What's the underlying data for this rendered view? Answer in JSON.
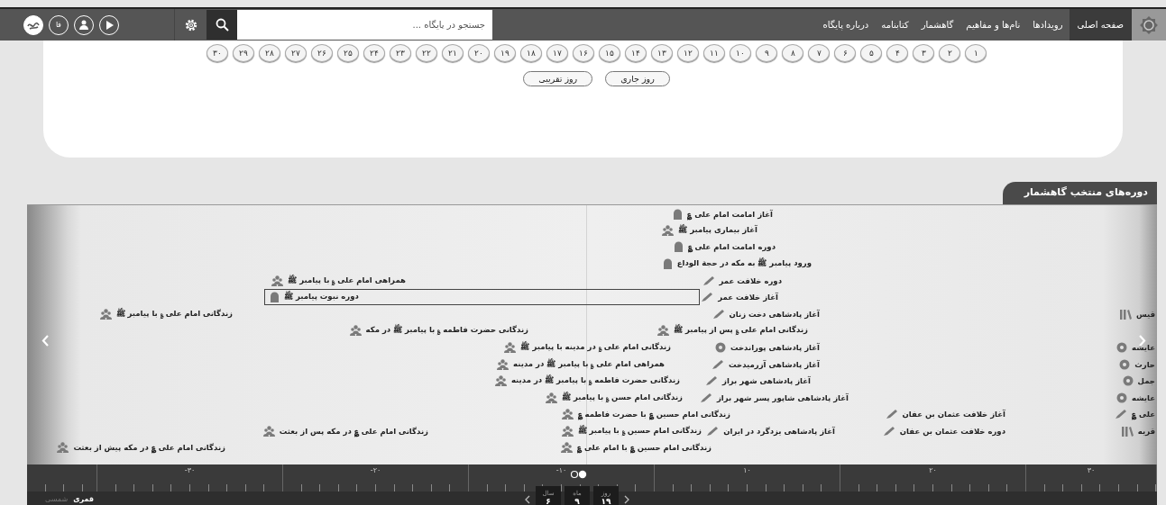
{
  "nav": {
    "items": [
      {
        "label": "صفحه اصلی",
        "selected": true
      },
      {
        "label": "رویدادها",
        "selected": false
      },
      {
        "label": "نام‌ها و مفاهیم",
        "selected": false
      },
      {
        "label": "گاهشمار",
        "selected": false
      },
      {
        "label": "کتابنامه",
        "selected": false
      },
      {
        "label": "درباره پایگاه",
        "selected": false
      }
    ],
    "search": {
      "placeholder": "جستجو در پایگاه ..."
    },
    "language": "فا"
  },
  "days": [
    "۱",
    "۲",
    "۳",
    "۴",
    "۵",
    "۶",
    "۷",
    "۸",
    "۹",
    "۱۰",
    "۱۱",
    "۱۲",
    "۱۳",
    "۱۴",
    "۱۵",
    "۱۶",
    "۱۷",
    "۱۸",
    "۱۹",
    "۲۰",
    "۲۱",
    "۲۲",
    "۲۳",
    "۲۴",
    "۲۵",
    "۲۶",
    "۲۷",
    "۲۸",
    "۲۹",
    "۳۰"
  ],
  "day_buttons": [
    "روز جاری",
    "روز تقریبی"
  ],
  "section_title": "دوره‌های منتخب گاهشمار",
  "timeline": {
    "events": [
      {
        "text": "آغاز امامت امام علی ؏",
        "kind": "dome",
        "selected": false
      },
      {
        "text": "آغاز بیماری پیامبر ﷺ",
        "kind": "people",
        "selected": false
      },
      {
        "text": "دوره امامت امام علی ؏",
        "kind": "dome",
        "selected": false
      },
      {
        "text": "ورود پیامبر ﷺ به مکه در حجة الوداع",
        "kind": "dome",
        "selected": false
      },
      {
        "text": "دوره خلافت عمر",
        "kind": "pen",
        "selected": false
      },
      {
        "text": "همراهی امام علی ؏ با پیامبر ﷺ",
        "kind": "people",
        "selected": false
      },
      {
        "text": "آغاز خلافت عمر",
        "kind": "pen",
        "selected": false
      },
      {
        "text": "دوره نبوت پیامبر ﷺ",
        "kind": "dome",
        "selected": true
      },
      {
        "text": "قیس",
        "kind": "book",
        "selected": false
      },
      {
        "text": "آغاز پادشاهی دخت زنان",
        "kind": "pen",
        "selected": false
      },
      {
        "text": "زندگانی امام علی ؏ با پیامبر ﷺ",
        "kind": "people",
        "selected": false
      },
      {
        "text": "زندگانی امام علی ؏ پس از پیامبر ﷺ",
        "kind": "people",
        "selected": false
      },
      {
        "text": "زندگانی حضرت فاطمه ؏ با پیامبر ﷺ در مکه",
        "kind": "people",
        "selected": false
      },
      {
        "text": "عایشه",
        "kind": "disc",
        "selected": false
      },
      {
        "text": "آغاز پادشاهی پوراندخت",
        "kind": "disc",
        "selected": false
      },
      {
        "text": "زندگانی امام علی ؏ در مدینه با پیامبر ﷺ",
        "kind": "people",
        "selected": false
      },
      {
        "text": "حارث",
        "kind": "disc",
        "selected": false
      },
      {
        "text": "آغاز پادشاهی آزرمیدخت",
        "kind": "pen",
        "selected": false
      },
      {
        "text": "همراهی امام علی ؏ با پیامبر ﷺ در مدینه",
        "kind": "people",
        "selected": false
      },
      {
        "text": "جمل",
        "kind": "disc",
        "selected": false
      },
      {
        "text": "آغاز پادشاهی شهر براز",
        "kind": "pen",
        "selected": false
      },
      {
        "text": "زندگانی حضرت فاطمه ؏ با پیامبر ﷺ در مدینه",
        "kind": "people",
        "selected": false
      },
      {
        "text": "عایشه",
        "kind": "disc",
        "selected": false
      },
      {
        "text": "آغاز پادشاهی شاپور پسر شهر براز",
        "kind": "pen",
        "selected": false
      },
      {
        "text": "زندگانی امام حسن ؏ با پیامبر ﷺ",
        "kind": "people",
        "selected": false
      },
      {
        "text": "علی ؏",
        "kind": "pen",
        "selected": false
      },
      {
        "text": "آغاز خلافت عثمان بن عفان",
        "kind": "pen",
        "selected": false
      },
      {
        "text": "زندگانی امام حسین ؏ با حضرت فاطمه ؏",
        "kind": "people",
        "selected": false
      },
      {
        "text": "قریه",
        "kind": "book",
        "selected": false
      },
      {
        "text": "دوره خلافت عثمان بن عفان",
        "kind": "pen",
        "selected": false
      },
      {
        "text": "آغاز پادشاهی یزدگرد در ایران",
        "kind": "pen",
        "selected": false
      },
      {
        "text": "زندگانی امام حسین ؏ با پیامبر ﷺ",
        "kind": "people",
        "selected": false
      },
      {
        "text": "زندگانی امام علی ؏ در مکه پس از بعثت",
        "kind": "people",
        "selected": false
      },
      {
        "text": "زندگانی امام حسین ؏ با امام علی ؏",
        "kind": "people",
        "selected": false
      },
      {
        "text": "زندگانی امام علی ؏ در مکه پیش از بعثت",
        "kind": "people",
        "selected": false
      }
    ],
    "ruler_labels": [
      "۳۰",
      "۲۰",
      "۱۰",
      "۱۰-",
      "۲۰-",
      "۳۰-"
    ]
  },
  "calendars": [
    {
      "label": "قمری",
      "selected": true
    },
    {
      "label": "شمسی",
      "selected": false
    }
  ],
  "date": [
    {
      "label": "روز",
      "value": "۱۹"
    },
    {
      "label": "ماه",
      "value": "۹"
    },
    {
      "label": "سال",
      "value": "۶"
    }
  ]
}
